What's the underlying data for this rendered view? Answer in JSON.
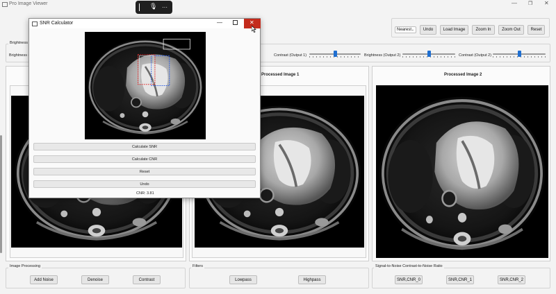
{
  "window": {
    "title": "Pro Image Viewer"
  },
  "floating_bar": {
    "more": "···"
  },
  "toolbar": {
    "interpolation": "Nearest",
    "undo": "Undo",
    "load_image": "Load Image",
    "zoom_in": "Zoom In",
    "zoom_out": "Zoom Out",
    "reset": "Reset"
  },
  "sliders": {
    "brightness_group_label": "Brightness a",
    "brightness_input": "Brightness (",
    "contrast_output1": "Contrast (Output 1)",
    "brightness_output2": "Brightness (Output 2)",
    "contrast_output2": "Contrast (Output 2)",
    "contrast_output1_level": 0.5,
    "brightness_output2_level": 0.5,
    "contrast_output2_level": 0.5
  },
  "panels": {
    "processed1_title": "Processed Image 1",
    "processed2_title": "Processed Image 2"
  },
  "bottom": {
    "image_processing": {
      "label": "Image Processing",
      "buttons": [
        "Add Noise",
        "Denoise",
        "Contrast"
      ]
    },
    "filters": {
      "label": "Filters",
      "buttons": [
        "Lowpass",
        "Highpass"
      ]
    },
    "snr": {
      "label": "Signal-to-Noise   Contrast-to-Noise Ratio",
      "buttons": [
        "SNR,CNR_0",
        "SNR,CNR_1",
        "SNR,CNR_2"
      ]
    }
  },
  "dialog": {
    "title": "SNR Calculator",
    "buttons": {
      "calc_snr": "Calculate SNR",
      "calc_cnr": "Calculate CNR",
      "reset": "Reset",
      "undo": "Undo"
    },
    "result": "CNR: 3.81"
  },
  "colors": {
    "accent": "#1f6fd1",
    "close_red": "#c42b1c",
    "roi_red": "#e23030",
    "roi_blue": "#3060e0"
  }
}
